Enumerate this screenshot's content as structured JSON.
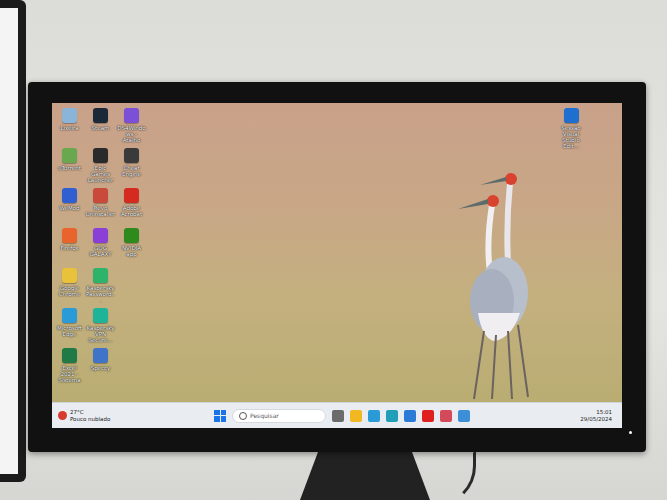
{
  "desktop": {
    "icons": [
      {
        "label": "Lixeira",
        "color": "#8ab4d8"
      },
      {
        "label": "uTorrent",
        "color": "#6aa84f"
      },
      {
        "label": "WeMod",
        "color": "#2f5fd0"
      },
      {
        "label": "Firefox",
        "color": "#e8642c"
      },
      {
        "label": "Google Chrome",
        "color": "#e8c23a"
      },
      {
        "label": "Microsoft Edge",
        "color": "#2b9bd8"
      },
      {
        "label": "Excel 2021 - Sistema",
        "color": "#1f7a45"
      },
      {
        "label": "Steam",
        "color": "#1b2838"
      },
      {
        "label": "Epic Games Launcher",
        "color": "#2a2a2a"
      },
      {
        "label": "Revo Uninstaller",
        "color": "#c94a3a"
      },
      {
        "label": "GOG GALAXY",
        "color": "#8a3fd6"
      },
      {
        "label": "Kaspersky Password...",
        "color": "#2db36a"
      },
      {
        "label": "Kaspersky VPN Secure...",
        "color": "#1fb39a"
      },
      {
        "label": "Speccy",
        "color": "#3f74c9"
      },
      {
        "label": "DS4Windows - Atalho",
        "color": "#7b4fd8"
      },
      {
        "label": "Cheat Engine",
        "color": "#3a3a3a"
      },
      {
        "label": "Adobe Acrobat",
        "color": "#d42a1f"
      },
      {
        "label": "NVIDIA app",
        "color": "#2f8a1e"
      }
    ],
    "corner_icon": {
      "label": "Sessão Visual Studio Edit...",
      "color": "#1e6fd0"
    }
  },
  "taskbar": {
    "weather": {
      "temperature": "27°C",
      "condition": "Pouco nublado"
    },
    "search": {
      "placeholder": "Pesquisar"
    },
    "apps": [
      {
        "color": "#6b6b6b"
      },
      {
        "color": "#f2b824"
      },
      {
        "color": "#2b9bd8"
      },
      {
        "color": "#1fa0b8"
      },
      {
        "color": "#2a7ad6"
      },
      {
        "color": "#e02020"
      },
      {
        "color": "#d44a5a"
      },
      {
        "color": "#3d8fd8"
      }
    ],
    "clock": {
      "time": "15:01",
      "date": "29/05/2024"
    }
  }
}
